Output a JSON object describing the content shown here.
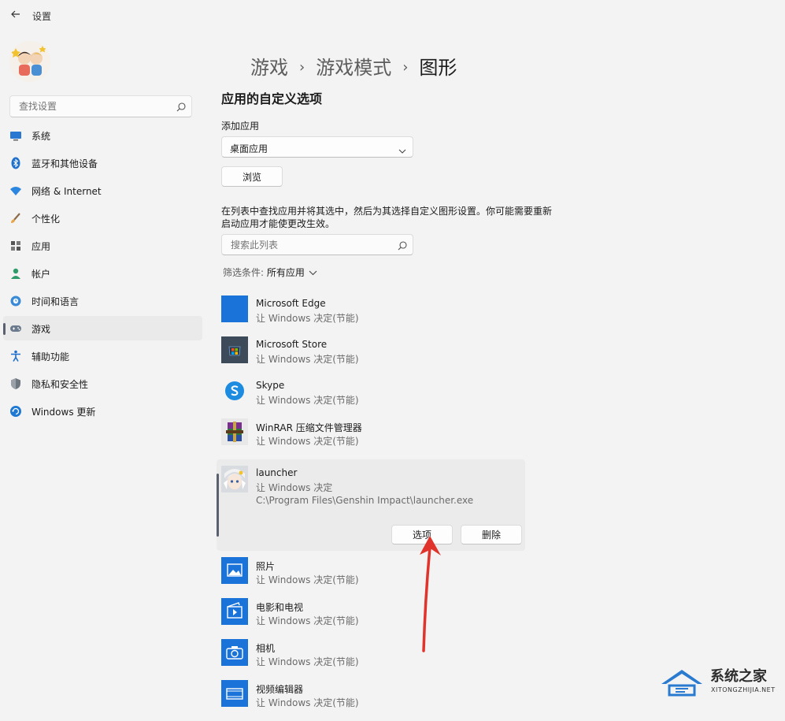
{
  "window": {
    "title": "设置"
  },
  "sidebar": {
    "search_placeholder": "查找设置",
    "items": [
      {
        "label": "系统",
        "icon": "monitor-icon"
      },
      {
        "label": "蓝牙和其他设备",
        "icon": "bluetooth-icon"
      },
      {
        "label": "网络 & Internet",
        "icon": "wifi-icon"
      },
      {
        "label": "个性化",
        "icon": "brush-icon"
      },
      {
        "label": "应用",
        "icon": "apps-icon"
      },
      {
        "label": "帐户",
        "icon": "person-icon"
      },
      {
        "label": "时间和语言",
        "icon": "globe-clock-icon"
      },
      {
        "label": "游戏",
        "icon": "gamepad-icon",
        "selected": true
      },
      {
        "label": "辅助功能",
        "icon": "accessibility-icon"
      },
      {
        "label": "隐私和安全性",
        "icon": "shield-icon"
      },
      {
        "label": "Windows 更新",
        "icon": "update-icon"
      }
    ]
  },
  "breadcrumb": {
    "items": [
      "游戏",
      "游戏模式",
      "图形"
    ],
    "separator": "›"
  },
  "content": {
    "section_title": "应用的自定义选项",
    "add_app_label": "添加应用",
    "dropdown_value": "桌面应用",
    "browse_label": "浏览",
    "description": "在列表中查找应用并将其选中，然后为其选择自定义图形设置。你可能需要重新启动应用才能使更改生效。",
    "list_search_placeholder": "搜索此列表",
    "filter_prefix": "筛选条件: ",
    "filter_value": "所有应用"
  },
  "apps": [
    {
      "name": "Microsoft Edge",
      "status": "让 Windows 决定(节能)",
      "icon": "edge-tile-icon"
    },
    {
      "name": "Microsoft Store",
      "status": "让 Windows 决定(节能)",
      "icon": "store-icon"
    },
    {
      "name": "Skype",
      "status": "让 Windows 决定(节能)",
      "icon": "skype-icon"
    },
    {
      "name": "WinRAR 压缩文件管理器",
      "status": "让 Windows 决定(节能)",
      "icon": "winrar-icon"
    },
    {
      "name": "launcher",
      "status": "让 Windows 决定",
      "path": "C:\\Program Files\\Genshin Impact\\launcher.exe",
      "icon": "genshin-launcher-icon",
      "expanded": true,
      "options_label": "选项",
      "delete_label": "删除"
    },
    {
      "name": "照片",
      "status": "让 Windows 决定(节能)",
      "icon": "photos-icon"
    },
    {
      "name": "电影和电视",
      "status": "让 Windows 决定(节能)",
      "icon": "movies-tv-icon"
    },
    {
      "name": "相机",
      "status": "让 Windows 决定(节能)",
      "icon": "camera-icon"
    },
    {
      "name": "视频编辑器",
      "status": "让 Windows 决定(节能)",
      "icon": "video-editor-icon"
    }
  ],
  "watermark": {
    "name": "系统之家",
    "url": "XITONGZHIJIA.NET"
  },
  "colors": {
    "accent": "#0067c0",
    "tile_blue": "#1a73d9",
    "arrow_red": "#e0332b",
    "background": "#f3f3f3"
  }
}
